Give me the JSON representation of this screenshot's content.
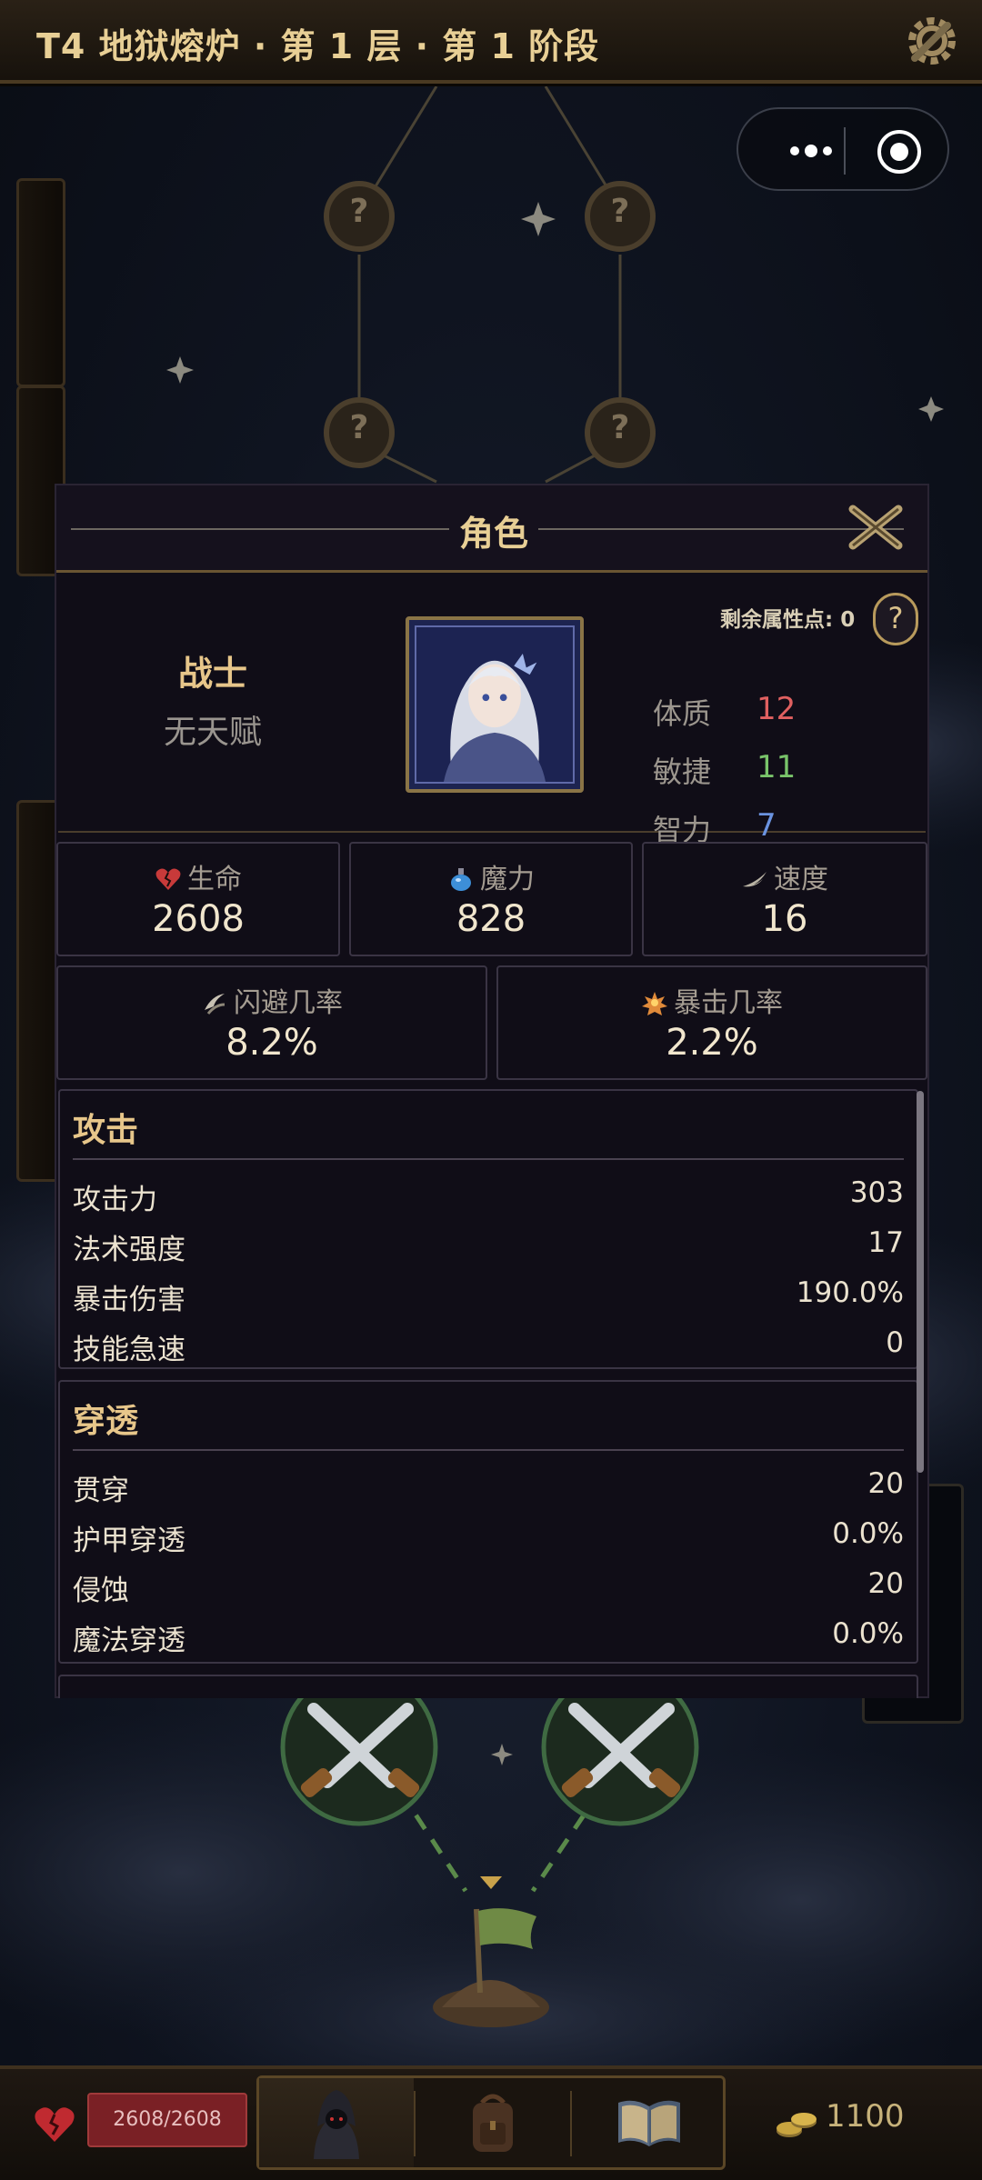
{
  "header": {
    "stage_title": "T4 地狱熔炉 · 第 1 层 · 第 1 阶段"
  },
  "map": {
    "unknown_mark": "?"
  },
  "panel": {
    "title": "角色",
    "class_name": "战士",
    "talent": "无天赋",
    "remaining_points_label": "剩余属性点: 0",
    "help_label": "?",
    "attributes": [
      {
        "name": "体质",
        "value": "12",
        "color": "#e06060"
      },
      {
        "name": "敏捷",
        "value": "11",
        "color": "#79c46a"
      },
      {
        "name": "智力",
        "value": "7",
        "color": "#6b93e0"
      }
    ],
    "core_stats": [
      {
        "label": "生命",
        "value": "2608",
        "icon": "broken-heart-icon"
      },
      {
        "label": "魔力",
        "value": "828",
        "icon": "potion-icon"
      },
      {
        "label": "速度",
        "value": "16",
        "icon": "wing-icon"
      }
    ],
    "chance_stats": [
      {
        "label": "闪避几率",
        "value": "8.2%",
        "icon": "dodge-icon"
      },
      {
        "label": "暴击几率",
        "value": "2.2%",
        "icon": "crit-icon"
      }
    ],
    "sections": [
      {
        "title": "攻击",
        "rows": [
          {
            "name": "攻击力",
            "value": "303"
          },
          {
            "name": "法术强度",
            "value": "17"
          },
          {
            "name": "暴击伤害",
            "value": "190.0%"
          },
          {
            "name": "技能急速",
            "value": "0"
          }
        ]
      },
      {
        "title": "穿透",
        "rows": [
          {
            "name": "贯穿",
            "value": "20"
          },
          {
            "name": "护甲穿透",
            "value": "0.0%"
          },
          {
            "name": "侵蚀",
            "value": "20"
          },
          {
            "name": "魔法穿透",
            "value": "0.0%"
          }
        ]
      }
    ]
  },
  "bottom": {
    "hp_text": "2608/2608",
    "gold": "1100",
    "nav": [
      "character-icon",
      "backpack-icon",
      "book-icon"
    ]
  },
  "colors": {
    "accent": "#e8cf95",
    "panel_bg": "#100d17",
    "hp_red": "#7a2025",
    "path_green": "#5a8a4a"
  }
}
